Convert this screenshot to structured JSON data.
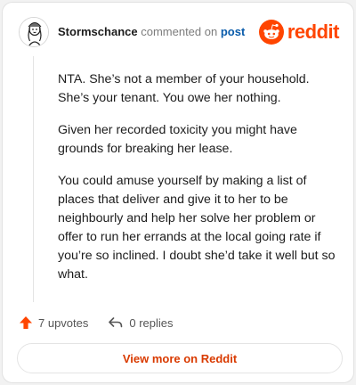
{
  "header": {
    "username": "Stormschance",
    "action": "commented on",
    "link_text": "post",
    "brand": "reddit"
  },
  "comment": {
    "paragraphs": [
      "NTA. She’s not a member of your household. She’s your tenant. You owe her nothing.",
      "Given her recorded toxicity you might have grounds for breaking her lease.",
      "You could amuse yourself by making a list of places that deliver and give it to her to be neighbourly and help her solve her problem or offer to run her errands at the local going rate if you’re so inclined. I doubt she’d take it well but so what."
    ]
  },
  "footer": {
    "upvotes": "7 upvotes",
    "replies": "0 replies"
  },
  "cta": {
    "label": "View more on Reddit"
  },
  "icons": {
    "upvote": "arrow-up-icon",
    "reply": "reply-arrow-icon",
    "brand": "reddit-snoo-icon"
  },
  "colors": {
    "brand": "#ff4500",
    "link": "#0a5cab",
    "cta": "#d93a00"
  }
}
